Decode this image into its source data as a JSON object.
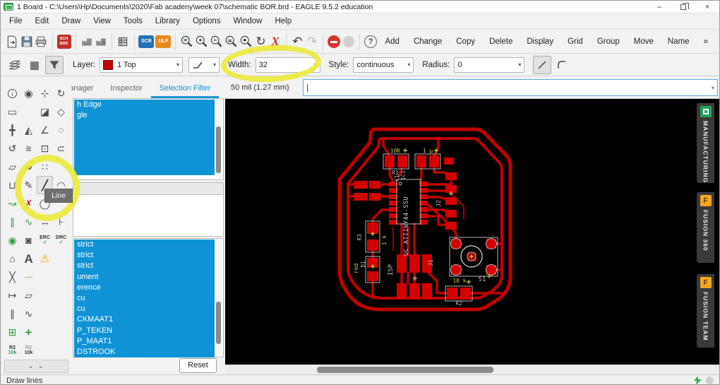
{
  "window": {
    "title": "1 Board - C:\\Users\\Hp\\Documents\\2020\\Fab acadeny\\week 07\\schematic BOR.brd - EAGLE 9.5.2 education",
    "minimize": "–",
    "close": "×"
  },
  "icons": {
    "caret_down": "▾",
    "help": "?",
    "cursor": "|",
    "chevrons": "⌄ ⌄",
    "undo": "↶",
    "redo": "↷",
    "refresh": "↻",
    "script_x": "X"
  },
  "menu": {
    "items": [
      "File",
      "Edit",
      "Draw",
      "View",
      "Tools",
      "Library",
      "Options",
      "Window",
      "Help"
    ]
  },
  "toolbar1": {
    "sch": "SCH",
    "brd": "BRD",
    "scr": "SCR",
    "ulp": "ULP",
    "zoom_in": "+",
    "zoom_out": "−"
  },
  "toolbar_right": {
    "items": [
      "Add",
      "Change",
      "Copy",
      "Delete",
      "Display",
      "Grid",
      "Group",
      "Move",
      "Name",
      "»"
    ]
  },
  "toolbar2": {
    "layer_label": "Layer:",
    "layer_value": "1 Top",
    "width_label": "Width:",
    "width_value": "32",
    "style_label": "Style:",
    "style_value": "continuous",
    "radius_label": "Radius:",
    "radius_value": "0"
  },
  "panel": {
    "tabs": [
      {
        "label": "Manager"
      },
      {
        "label": "Inspector"
      },
      {
        "label": "Selection Filter"
      }
    ],
    "top_list": [
      "h Edge",
      "gle"
    ],
    "bottom_list": [
      "strict",
      "strict",
      "strict",
      "ument",
      "erence",
      "cu",
      "cu",
      "CKMAAT1",
      "P_TEKEN",
      "P_MAAT1",
      "DSTROOK"
    ],
    "reset_label": "Reset"
  },
  "tools": [
    {
      "n": "info-tool",
      "g": "i",
      "c": "circ"
    },
    {
      "n": "show-tool",
      "g": "◉"
    },
    {
      "n": "mark-tool",
      "g": "⊹"
    },
    {
      "n": "rotate-group-tool",
      "g": "↻"
    },
    {
      "n": "select-tool",
      "g": "▭"
    },
    {
      "n": "",
      "g": ""
    },
    {
      "n": "delete-tool",
      "g": "◪"
    },
    {
      "n": "label-tool",
      "g": "◇"
    },
    {
      "n": "move-tool",
      "g": "╋"
    },
    {
      "n": "mirror-tool",
      "g": "◭"
    },
    {
      "n": "wire-tool",
      "g": "∠"
    },
    {
      "n": "optimize-tool",
      "g": "◌"
    },
    {
      "n": "rotate-tool",
      "g": "↺"
    },
    {
      "n": "align-tool",
      "g": "≡"
    },
    {
      "n": "lock-tool",
      "g": "⊡"
    },
    {
      "n": "split-tool",
      "g": "⊂"
    },
    {
      "n": "copy-tool",
      "g": "▱"
    },
    {
      "n": "paste-tool",
      "g": "▰"
    },
    {
      "n": "pinswap-tool",
      "g": "∷"
    },
    {
      "n": "",
      "g": ""
    },
    {
      "n": "trash-tool",
      "g": "⊔"
    },
    {
      "n": "glue-tool",
      "g": "✎"
    },
    {
      "n": "line-tool",
      "g": "╱",
      "c": "hl"
    },
    {
      "n": "arc-tool",
      "g": "◠"
    },
    {
      "n": "route-tool",
      "g": "↝",
      "c": "green"
    },
    {
      "n": "ripup-tool",
      "g": "✗",
      "c": "red"
    },
    {
      "n": "circle-tool",
      "g": "◯"
    },
    {
      "n": "",
      "g": ""
    },
    {
      "n": "route-diff-tool",
      "g": "∥",
      "c": "green"
    },
    {
      "n": "meander-route-tool",
      "g": "∿",
      "c": "green"
    },
    {
      "n": "dimension-tool",
      "g": "↔"
    },
    {
      "n": "measure-tool",
      "g": "⊦"
    },
    {
      "n": "via-tool",
      "g": "◉",
      "c": "green"
    },
    {
      "n": "pad-tool",
      "g": "◙"
    },
    {
      "n": "erc-tool",
      "g": "ERC",
      "g2": "✓",
      "c": "txt"
    },
    {
      "n": "drc-tool",
      "g": "DRC",
      "g2": "✓",
      "c": "txt"
    },
    {
      "n": "polygon-tool",
      "g": "⌂"
    },
    {
      "n": "text-tool",
      "g": "A",
      "c": "big"
    },
    {
      "n": "errors-tool",
      "g": "⚠",
      "c": "warn"
    },
    {
      "n": "",
      "g": ""
    },
    {
      "n": "ratsnest-tool",
      "g": "╳"
    },
    {
      "n": "signal-tool",
      "g": "∙─∙",
      "c": "small green"
    },
    {
      "n": "",
      "g": ""
    },
    {
      "n": "",
      "g": ""
    },
    {
      "n": "autoroute-tool",
      "g": "↦"
    },
    {
      "n": "polygon-pour-tool",
      "g": "▱"
    },
    {
      "n": "",
      "g": ""
    },
    {
      "n": "",
      "g": ""
    },
    {
      "n": "diff-pair-tool",
      "g": "∥"
    },
    {
      "n": "meander-tool",
      "g": "∿"
    },
    {
      "n": "",
      "g": ""
    },
    {
      "n": "",
      "g": ""
    },
    {
      "n": "add-3d-tool",
      "g": "⊞",
      "c": "green"
    },
    {
      "n": "add-part-tool",
      "g": "+",
      "c": "green big"
    },
    {
      "n": "",
      "g": ""
    },
    {
      "n": "",
      "g": ""
    },
    {
      "n": "name-tool",
      "g": "R2",
      "g2": "10k",
      "c": "txt"
    },
    {
      "n": "value-tool",
      "g": "R2",
      "g2": "10k",
      "c": "txt val"
    },
    {
      "n": "",
      "g": ""
    },
    {
      "n": "",
      "g": ""
    }
  ],
  "canvas": {
    "grid_readout": "50 mil (1.27 mm)"
  },
  "side_tabs": {
    "manufacturing": "MANUFACTURING",
    "fusion360": "FUSION 360",
    "fusionteam": "FUSION TEAM"
  },
  "tooltip": {
    "line": "Line"
  },
  "statusbar": {
    "text": "Draw lines"
  },
  "pcb": {
    "labels": {
      "r1_value": "10K",
      "r1_name": "R1",
      "c1_value": "1 µ",
      "c1_name": "C1",
      "ic_name": "IC1",
      "ic_text": "UC ATTINY44-SSU",
      "j2": "J2",
      "r3_name": "R3",
      "r3_value": "1 k",
      "d1_value": "red",
      "d1_name": "D1",
      "isp": "ISP",
      "j1": "J1",
      "s1": "S1",
      "r2_value": "10 k",
      "r2_name": "R2"
    }
  }
}
